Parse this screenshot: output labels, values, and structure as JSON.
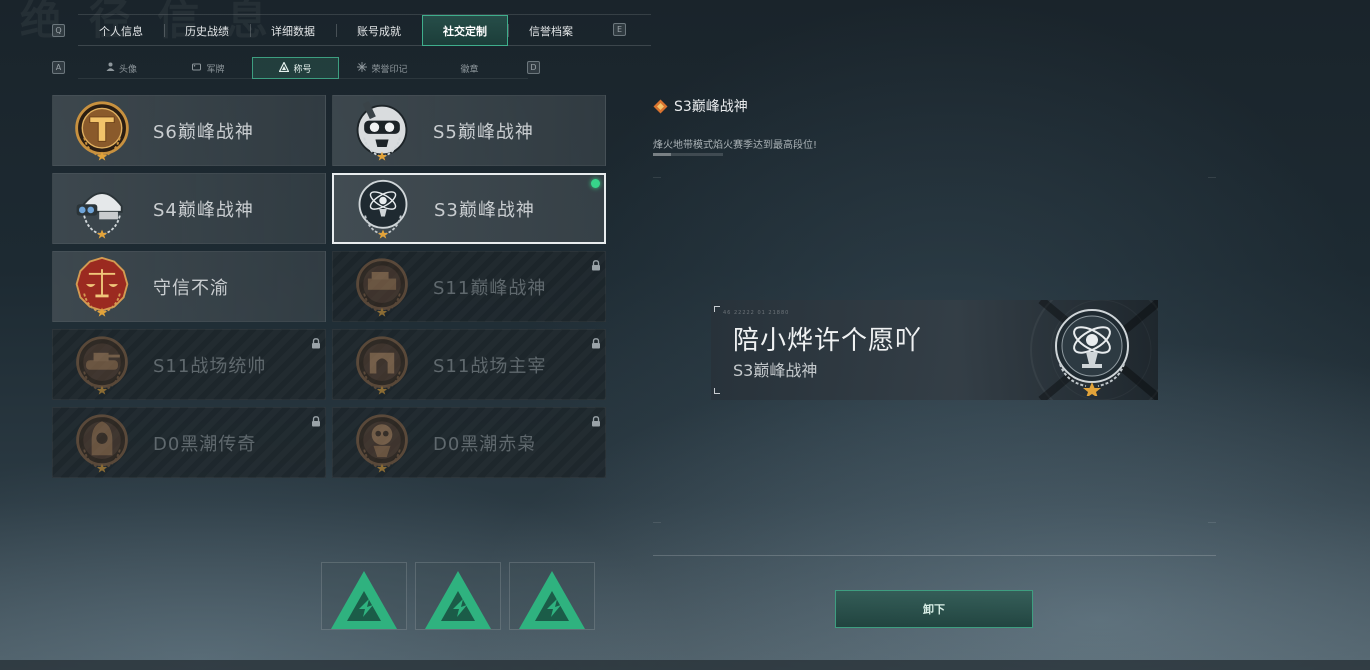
{
  "background_title": "绝 径 信 息",
  "main_tabs": {
    "left_key": "Q",
    "right_key": "E",
    "items": [
      {
        "label": "个人信息"
      },
      {
        "label": "历史战绩"
      },
      {
        "label": "详细数据"
      },
      {
        "label": "账号成就"
      },
      {
        "label": "社交定制",
        "active": true
      },
      {
        "label": "信誉档案"
      }
    ]
  },
  "sub_tabs": {
    "left_key": "A",
    "right_key": "D",
    "items": [
      {
        "label": "头像",
        "icon": "person-icon"
      },
      {
        "label": "军牌",
        "icon": "dogtag-icon"
      },
      {
        "label": "称号",
        "icon": "title-icon",
        "active": true
      },
      {
        "label": "荣誉印记",
        "icon": "honor-mark-icon"
      },
      {
        "label": "徽章",
        "icon": ""
      }
    ]
  },
  "titles": [
    {
      "name": "S6巅峰战神",
      "badge": "gold-t-emblem",
      "locked": false
    },
    {
      "name": "S5巅峰战神",
      "badge": "skull-diver-helmet",
      "locked": false
    },
    {
      "name": "S4巅峰战神",
      "badge": "nightvision-helmet",
      "locked": false
    },
    {
      "name": "S3巅峰战神",
      "badge": "armillary-sphere",
      "locked": false,
      "selected": true
    },
    {
      "name": "守信不渝",
      "badge": "justice-scales",
      "locked": false
    },
    {
      "name": "S11巅峰战神",
      "badge": "bronze-vehicle",
      "locked": true
    },
    {
      "name": "S11战场统帅",
      "badge": "bronze-tank",
      "locked": true
    },
    {
      "name": "S11战场主宰",
      "badge": "bronze-arch",
      "locked": true
    },
    {
      "name": "D0黑潮传奇",
      "badge": "bronze-hooded-figure",
      "locked": true
    },
    {
      "name": "D0黑潮赤枭",
      "badge": "bronze-skull-figure",
      "locked": true
    }
  ],
  "detail": {
    "title": "S3巅峰战神",
    "description": "烽火地带模式焰火赛季达到最高段位!"
  },
  "preview": {
    "code": "46 22222  01 21880",
    "player_name": "陪小烨许个愿吖",
    "title": "S3巅峰战神"
  },
  "action_button": "卸下",
  "colors": {
    "accent": "#3fae8c",
    "equipped_dot": "#37d48a",
    "gold": "#c89b4a",
    "bronze": "#8a6444"
  }
}
